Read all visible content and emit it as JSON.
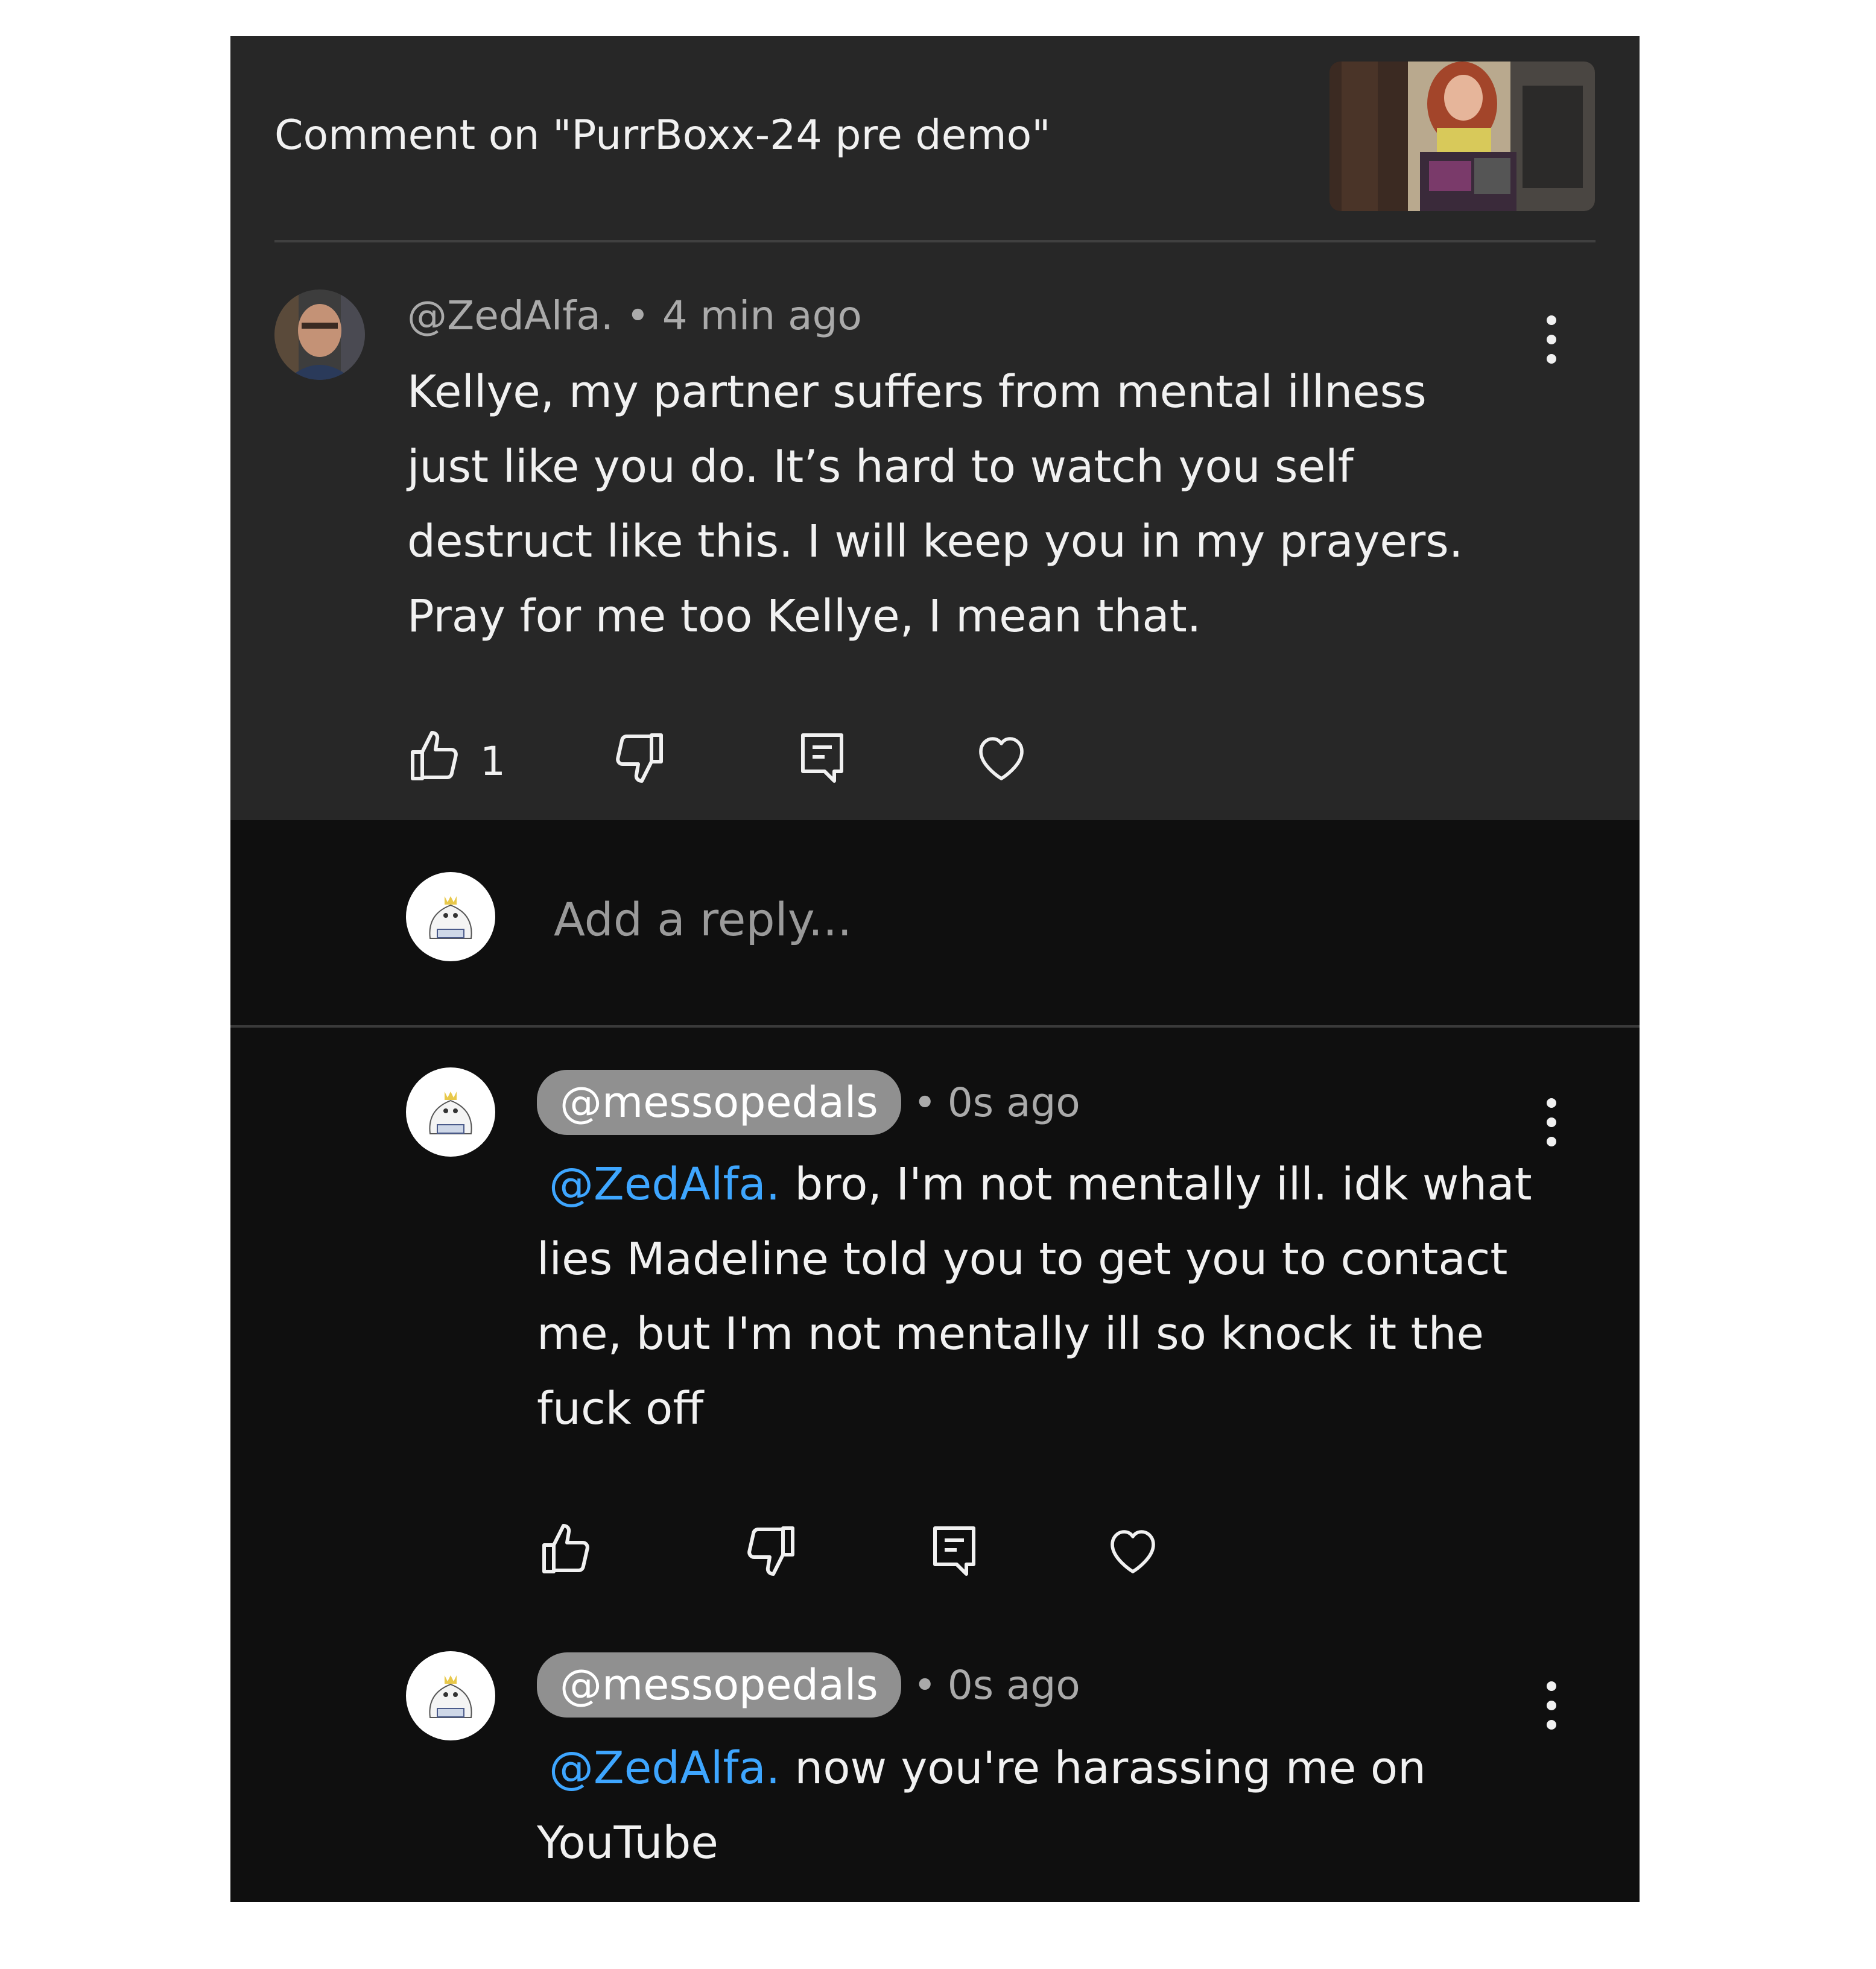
{
  "header": {
    "title": "Comment on \"PurrBoxx-24 pre demo\""
  },
  "comment": {
    "author": "@ZedAlfa.",
    "separator": "•",
    "time": "4 min ago",
    "text": "Kellye, my partner suffers from mental illness just like you do. It’s hard to watch you self destruct like this. I will keep you in my prayers. Pray for me too Kellye, I mean that.",
    "likes": "1"
  },
  "reply_box": {
    "placeholder": "Add a reply..."
  },
  "replies": [
    {
      "author": "@messopedals",
      "separator": "•",
      "time": "0s ago",
      "mention": "@ZedAlfa.",
      "text": "bro, I'm not mentally ill. idk what lies Madeline told you to get you to contact me, but I'm not mentally ill so knock it the fuck off"
    },
    {
      "author": "@messopedals",
      "separator": "•",
      "time": "0s ago",
      "mention": "@ZedAlfa.",
      "text": "now you're harassing me on YouTube"
    }
  ],
  "icons": {
    "like": "thumbs-up-icon",
    "dislike": "thumbs-down-icon",
    "reply": "comment-reply-icon",
    "heart": "heart-icon",
    "more": "more-vert-icon"
  },
  "colors": {
    "panel_top": "#272727",
    "panel_bottom": "#0f0f0f",
    "mention": "#3ea6ff",
    "pill": "#909090"
  }
}
